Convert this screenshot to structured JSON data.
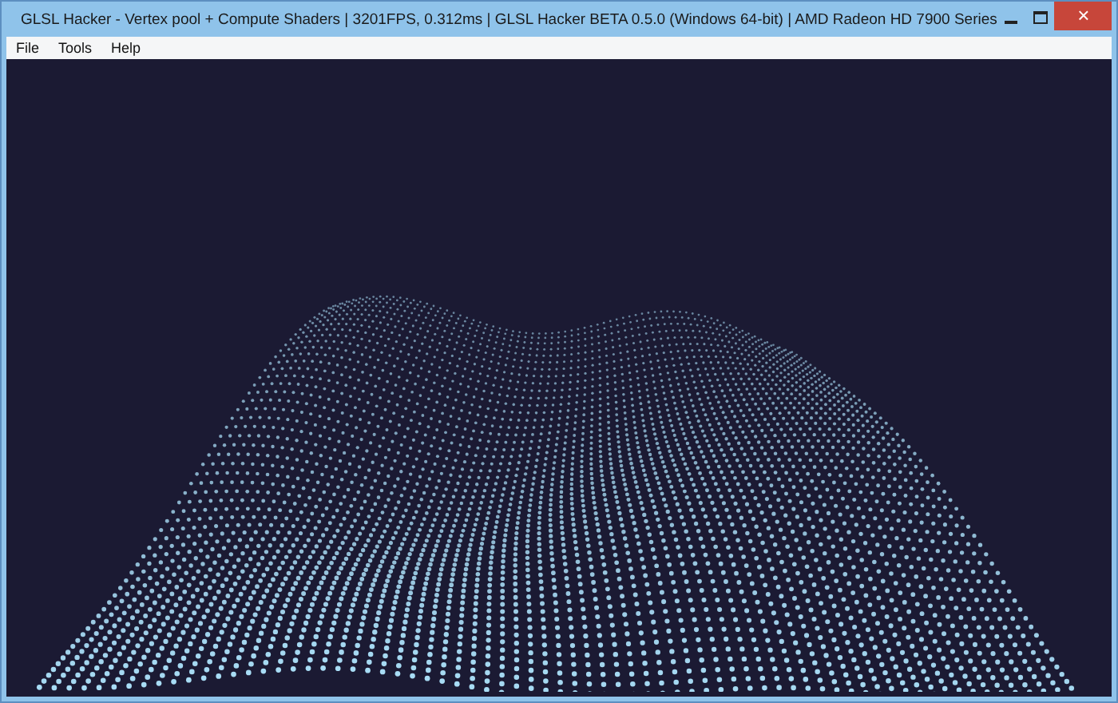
{
  "window": {
    "title": "GLSL Hacker - Vertex pool + Compute Shaders | 3201FPS, 0.312ms | GLSL Hacker BETA 0.5.0 (Windows 64-bit) | AMD Radeon HD 7900 Series"
  },
  "window_controls": {
    "close": "×"
  },
  "menu": [
    "File",
    "Tools",
    "Help"
  ]
}
